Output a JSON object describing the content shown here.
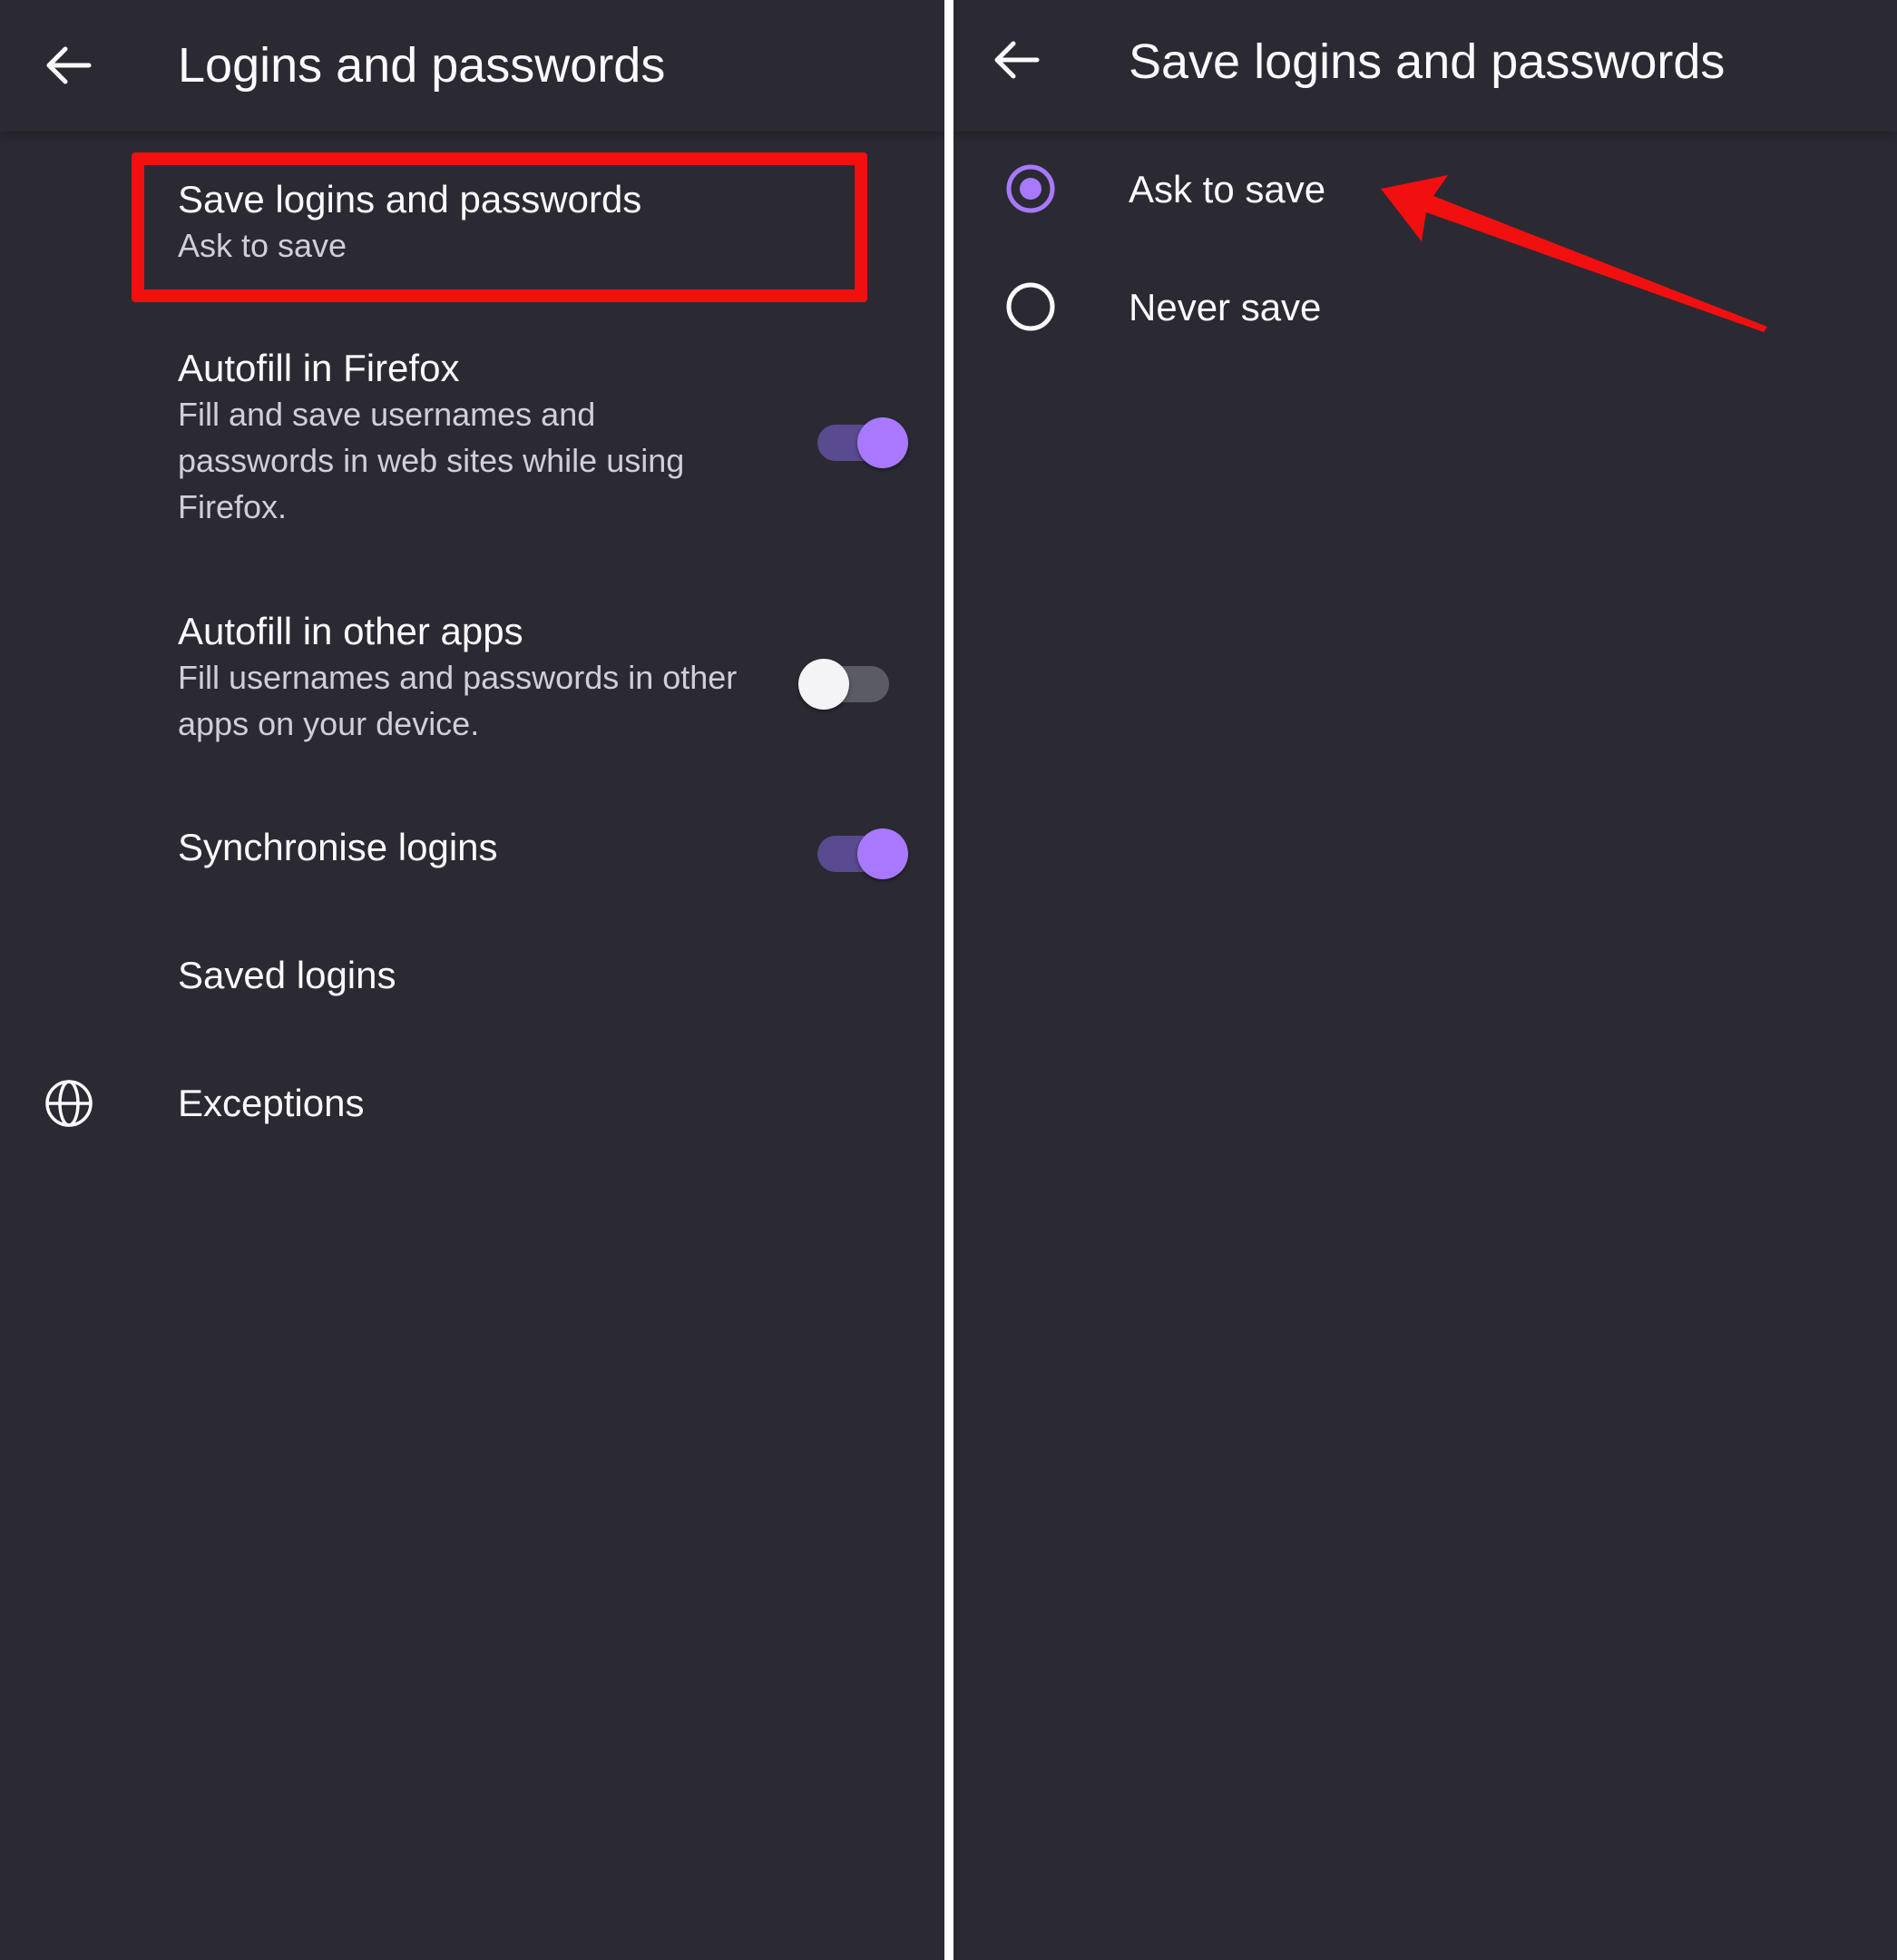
{
  "left_panel": {
    "title": "Logins and passwords",
    "back_icon": "arrow-left-icon",
    "items": [
      {
        "title": "Save logins and passwords",
        "subtitle": "Ask to save"
      },
      {
        "title": "Autofill in Firefox",
        "subtitle": "Fill and save usernames and passwords in web sites while using Firefox.",
        "toggle": true
      },
      {
        "title": "Autofill in other apps",
        "subtitle": "Fill usernames and passwords in other apps on your device.",
        "toggle": false
      },
      {
        "title": "Synchronise logins",
        "toggle": true
      },
      {
        "title": "Saved logins"
      },
      {
        "title": "Exceptions",
        "icon": "globe-icon"
      }
    ]
  },
  "right_panel": {
    "title": "Save logins and passwords",
    "back_icon": "arrow-left-icon",
    "options": [
      {
        "label": "Ask to save",
        "selected": true
      },
      {
        "label": "Never save",
        "selected": false
      }
    ]
  },
  "colors": {
    "background": "#2b2a33",
    "accent": "#a879ff",
    "annotation": "#f20f0f",
    "text_primary": "#fbfbfe",
    "text_secondary": "#cfcfd8"
  }
}
